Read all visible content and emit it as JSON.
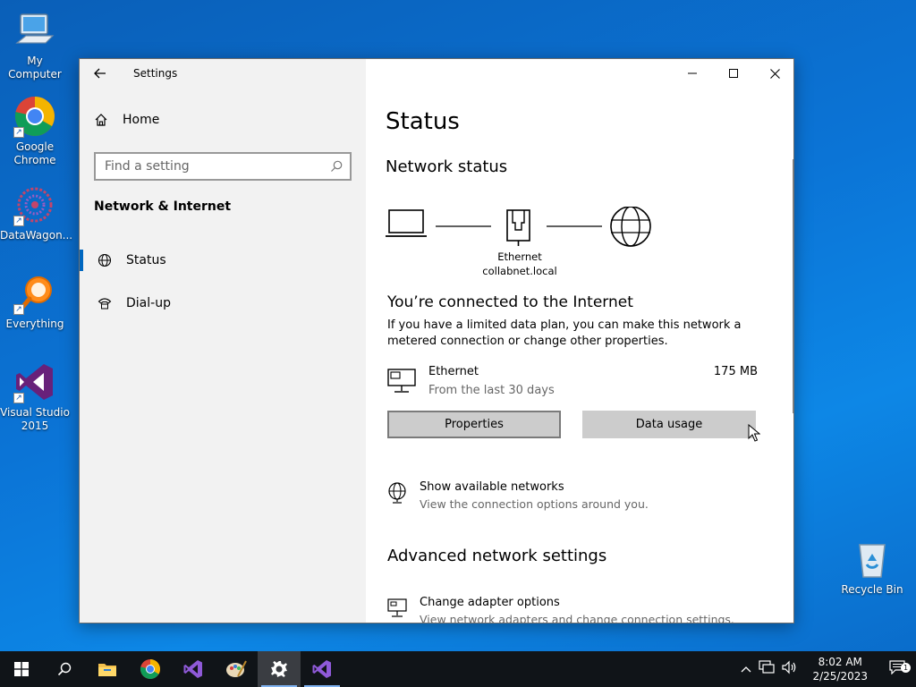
{
  "desktop": {
    "icons": [
      {
        "label": "My Computer"
      },
      {
        "label": "Google Chrome"
      },
      {
        "label": "DataWagon..."
      },
      {
        "label": "Everything"
      },
      {
        "label": "Visual Studio 2015"
      },
      {
        "label": "Recycle Bin"
      }
    ]
  },
  "window": {
    "title": "Settings",
    "controls": {
      "minimize": "─",
      "maximize": "☐",
      "close": "✕"
    }
  },
  "sidebar": {
    "home_label": "Home",
    "search_placeholder": "Find a setting",
    "section_title": "Network & Internet",
    "items": [
      {
        "label": "Status",
        "icon": "globe-icon",
        "active": true
      },
      {
        "label": "Dial-up",
        "icon": "phone-icon",
        "active": false
      }
    ]
  },
  "main": {
    "title": "Status",
    "network_status_title": "Network status",
    "adapter_label": "Ethernet",
    "domain_label": "collabnet.local",
    "connected_heading": "You’re connected to the Internet",
    "connected_text": "If you have a limited data plan, you can make this network a metered connection or change other properties.",
    "ethernet": {
      "name": "Ethernet",
      "subtitle": "From the last 30 days",
      "usage": "175 MB"
    },
    "buttons": {
      "properties": "Properties",
      "data_usage": "Data usage"
    },
    "show_networks": {
      "title": "Show available networks",
      "description": "View the connection options around you."
    },
    "advanced_title": "Advanced network settings",
    "change_adapter": {
      "title": "Change adapter options",
      "description": "View network adapters and change connection settings."
    }
  },
  "taskbar": {
    "apps": [
      "start",
      "search",
      "file-explorer",
      "chrome",
      "visual-studio",
      "paint",
      "settings",
      "visual-studio-2015"
    ],
    "time": "8:02 AM",
    "date": "2/25/2023",
    "notification_count": "1"
  },
  "colors": {
    "accent": "#0067c0",
    "desktop": "#0b74d6",
    "taskbar": "#101418"
  }
}
